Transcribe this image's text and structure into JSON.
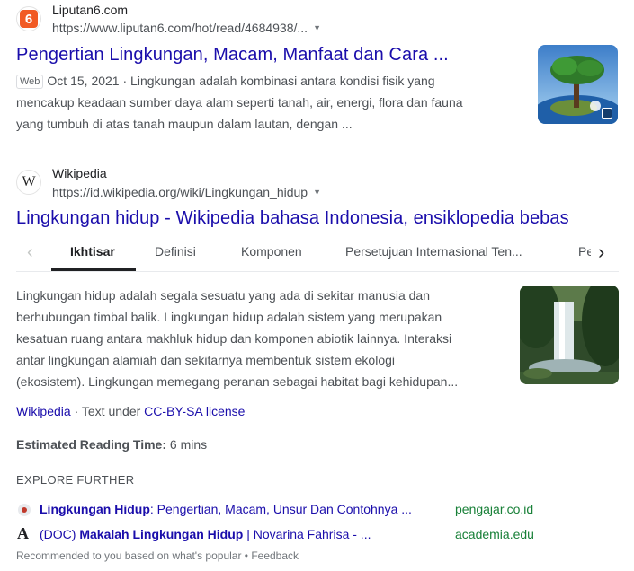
{
  "result1": {
    "favicon_text": "6",
    "site_name": "Liputan6.com",
    "url": "https://www.liputan6.com/hot/read/4684938/...",
    "title": "Pengertian Lingkungan, Macam, Manfaat dan Cara ...",
    "badge": "Web",
    "date": "Oct 15, 2021",
    "snippet_line1": "Lingkungan adalah kombinasi antara kondisi fisik yang",
    "snippet_line2": "mencakup keadaan sumber daya alam seperti tanah, air, energi, flora dan fauna",
    "snippet_line3": "yang tumbuh di atas tanah maupun dalam lautan, dengan ..."
  },
  "result2": {
    "favicon_text": "W",
    "site_name": "Wikipedia",
    "url": "https://id.wikipedia.org/wiki/Lingkungan_hidup",
    "title": "Lingkungan hidup - Wikipedia bahasa Indonesia, ensiklopedia bebas",
    "tabs": [
      "Ikhtisar",
      "Definisi",
      "Komponen",
      "Persetujuan Internasional Ten...",
      "Pe"
    ],
    "snippet_lines": [
      "Lingkungan hidup adalah segala sesuatu yang ada di sekitar manusia dan",
      "berhubungan timbal balik. Lingkungan hidup adalah sistem yang merupakan",
      "kesatuan ruang antara makhluk hidup dan komponen abiotik lainnya. Interaksi",
      "antar lingkungan alamiah dan sekitarnya membentuk sistem ekologi",
      "(ekosistem). Lingkungan memegang peranan sebagai habitat bagi kehidupan..."
    ],
    "source_link": "Wikipedia",
    "license_prefix": " · Text under ",
    "license_link": "CC-BY-SA license",
    "reading_label": "Estimated Reading Time:",
    "reading_value": " 6 mins"
  },
  "explore": {
    "header": "EXPLORE FURTHER",
    "items": [
      {
        "title_bold": "Lingkungan Hidup",
        "title_rest": ": Pengertian, Macam, Unsur Dan Contohnya ...",
        "domain": "pengajar.co.id",
        "icon": "pengajar-favicon"
      },
      {
        "prefix": "(DOC) ",
        "title_bold": "Makalah Lingkungan Hidup",
        "title_rest": " | Novarina Fahrisa - ...",
        "domain": "academia.edu",
        "icon_text": "A"
      }
    ],
    "footer": "Recommended to you based on what's popular • Feedback"
  },
  "colors": {
    "link": "#1a0dab",
    "green": "#188038",
    "snippet": "#4d5156"
  }
}
